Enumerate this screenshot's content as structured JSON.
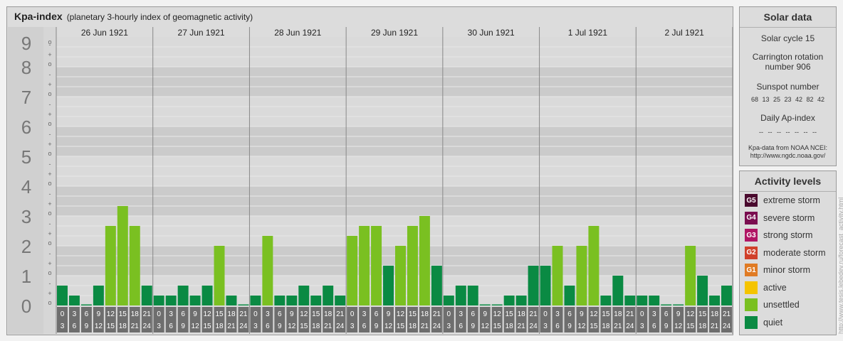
{
  "header": {
    "title": "Kpa-index",
    "subtitle": "(planetary 3-hourly index of geomagnetic activity)"
  },
  "chart_data": {
    "type": "bar",
    "ylim": [
      0,
      9
    ],
    "y_tick_labels": [
      "0",
      "1",
      "2",
      "3",
      "4",
      "5",
      "6",
      "7",
      "8",
      "9"
    ],
    "sub_tick_labels": [
      "+",
      "o",
      "-"
    ],
    "days": [
      "26 Jun 1921",
      "27 Jun 1921",
      "28 Jun 1921",
      "29 Jun 1921",
      "30 Jun 1921",
      "1 Jul 1921",
      "2 Jul 1921"
    ],
    "interval_top": [
      "0",
      "3",
      "6",
      "9",
      "12",
      "15",
      "18",
      "21"
    ],
    "interval_bottom": [
      "3",
      "6",
      "9",
      "12",
      "15",
      "18",
      "21",
      "24"
    ],
    "values": [
      [
        0.667,
        0.333,
        0.0,
        0.667,
        2.667,
        3.333,
        2.667,
        0.667
      ],
      [
        0.333,
        0.333,
        0.667,
        0.333,
        0.667,
        2.0,
        0.333,
        0.0
      ],
      [
        0.333,
        2.333,
        0.333,
        0.333,
        0.667,
        0.333,
        0.667,
        0.333
      ],
      [
        2.333,
        2.667,
        2.667,
        1.333,
        2.0,
        2.667,
        3.0,
        1.333
      ],
      [
        0.333,
        0.667,
        0.667,
        0.0,
        0.0,
        0.333,
        0.333,
        1.333
      ],
      [
        1.333,
        2.0,
        0.667,
        2.0,
        2.667,
        0.333,
        1.0,
        0.333
      ],
      [
        0.333,
        0.333,
        0.0,
        0.0,
        2.0,
        1.0,
        0.333,
        0.667
      ]
    ],
    "colors": {
      "quiet": "#0a8a43",
      "unsettled": "#7ac021",
      "active": "#f5c400",
      "g1": "#e07b24",
      "g2": "#d0402a",
      "g3": "#b01564",
      "g4": "#7a0d4f",
      "g5": "#4a0a2e"
    }
  },
  "solar": {
    "title": "Solar data",
    "cycle": "Solar cycle 15",
    "carrington": "Carrington rotation number 906",
    "sunspot_title": "Sunspot number",
    "sunspots": "68 13 25 23 42 82 42",
    "ap_title": "Daily Ap-index",
    "ap_values": "-- -- -- -- -- -- --",
    "source": "Kpa-data from NOAA NCEI: http://www.ngdc.noaa.gov/"
  },
  "levels": {
    "title": "Activity levels",
    "items": [
      {
        "code": "G5",
        "label": "extreme storm",
        "color": "#4a0a2e"
      },
      {
        "code": "G4",
        "label": "severe storm",
        "color": "#7a0d4f"
      },
      {
        "code": "G3",
        "label": "strong storm",
        "color": "#b01564"
      },
      {
        "code": "G2",
        "label": "moderate storm",
        "color": "#d0402a"
      },
      {
        "code": "G1",
        "label": "minor storm",
        "color": "#e07b24"
      },
      {
        "code": "",
        "label": "active",
        "color": "#f5c400"
      },
      {
        "code": "",
        "label": "unsettled",
        "color": "#7ac021"
      },
      {
        "code": "",
        "label": "quiet",
        "color": "#0a8a43"
      }
    ]
  },
  "credit": "http://www.tesis.lebedev.ru/forecast_activity.html"
}
